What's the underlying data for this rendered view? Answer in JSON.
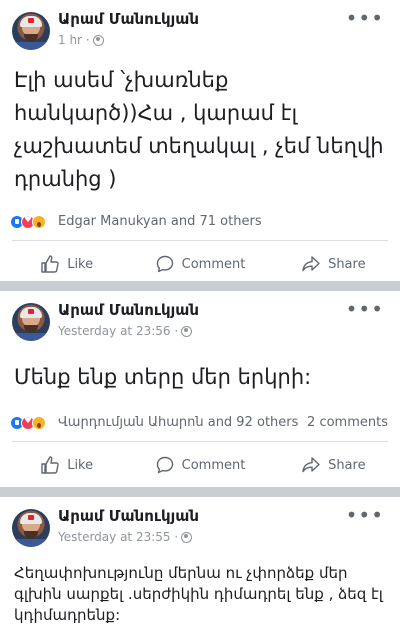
{
  "posts": [
    {
      "author": "Արամ Մանուկյան",
      "time": "1 hr ·",
      "text": "Էլի ասեմ ՝չխառնեք հանկարծ))Հա , կարամ էլ չաշխատեմ տեղակալ , չեմ նեղվի դրանից )",
      "reaction_text": "Edgar Manukyan and 71 others",
      "comments": ""
    },
    {
      "author": "Արամ Մանուկյան",
      "time": "Yesterday at 23:56 ·",
      "text": "Մենք ենք տերը մեր երկրի:",
      "reaction_text": "Վարդումյան Ահարոն and 92 others",
      "comments": "2 comments"
    },
    {
      "author": "Արամ Մանուկյան",
      "time": "Yesterday at 23:55 ·",
      "text": "Հեղափոխությունը մերնա ու չփորձեք մեր գլխին սարքել .սերժիկին դիմադրել ենք , ձեզ էլ կդիմադրենք:"
    }
  ],
  "actions": {
    "like": "Like",
    "comment": "Comment",
    "share": "Share"
  },
  "colors": {
    "like_reaction": "#1877f2",
    "love_reaction": "#f33e58",
    "wow_reaction": "#f7b125",
    "secondary_text": "#606770"
  }
}
